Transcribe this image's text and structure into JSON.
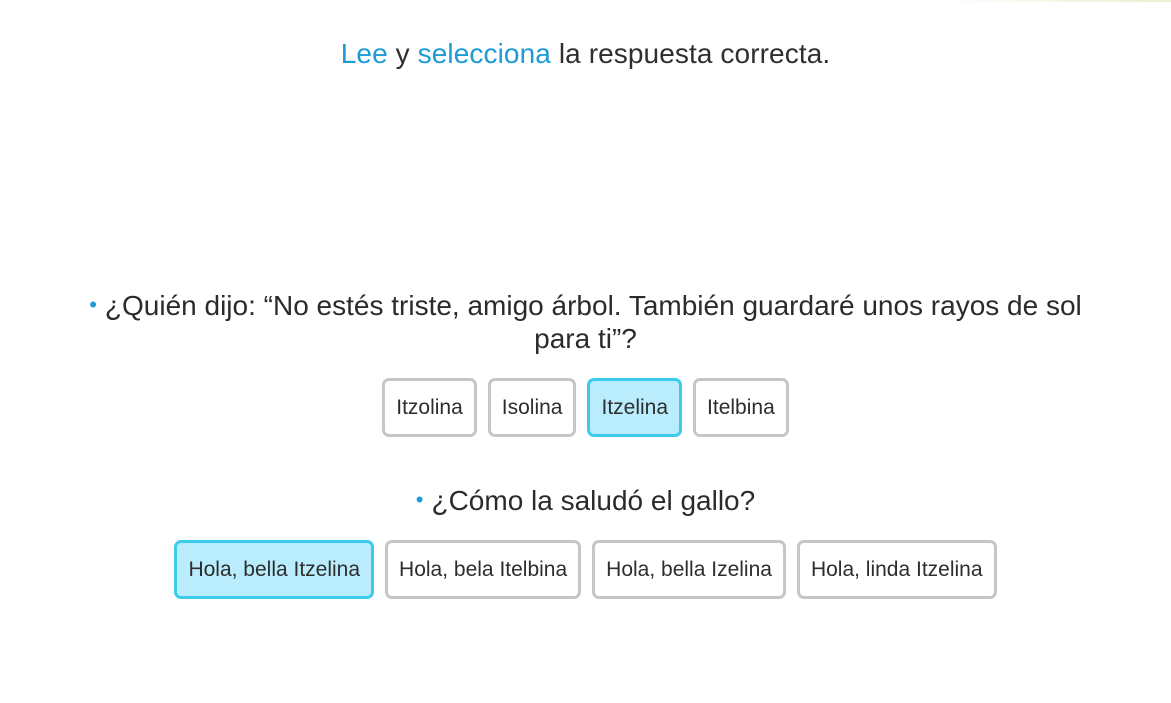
{
  "instruction": {
    "word1": "Lee",
    "connector": " y ",
    "word2": "selecciona",
    "rest": " la respuesta correcta."
  },
  "questions": [
    {
      "bullet": "•",
      "text": "¿Quién dijo: “No estés triste, amigo árbol. También guardaré unos rayos de sol para ti”?",
      "options": [
        {
          "label": "Itzolina",
          "selected": false
        },
        {
          "label": "Isolina",
          "selected": false
        },
        {
          "label": "Itzelina",
          "selected": true
        },
        {
          "label": "Itelbina",
          "selected": false
        }
      ]
    },
    {
      "bullet": "•",
      "text": "¿Cómo la saludó el gallo?",
      "options": [
        {
          "label": "Hola, bella Itzelina",
          "selected": true
        },
        {
          "label": "Hola, bela Itelbina",
          "selected": false
        },
        {
          "label": "Hola, bella Izelina",
          "selected": false
        },
        {
          "label": "Hola, linda Itzelina",
          "selected": false
        }
      ]
    }
  ],
  "colors": {
    "keyword": "#1b9bd7",
    "selected_fill": "#b9ecfc",
    "selected_border": "#3ccbed",
    "default_border": "#c6c6c6"
  }
}
